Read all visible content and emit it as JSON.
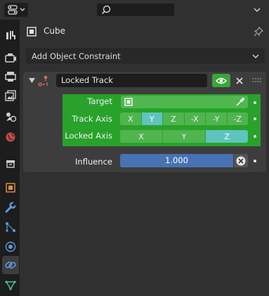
{
  "header": {
    "editor_type_icon": "properties-editor-icon",
    "search_icon": "search-icon",
    "search_placeholder": ""
  },
  "tabs": [
    {
      "name": "tool",
      "icon": "tool-icon"
    },
    {
      "name": "render",
      "icon": "render-icon"
    },
    {
      "name": "output",
      "icon": "output-icon"
    },
    {
      "name": "view-layer",
      "icon": "view-layer-icon"
    },
    {
      "name": "scene",
      "icon": "scene-icon"
    },
    {
      "name": "world",
      "icon": "world-icon"
    },
    {
      "name": "collection",
      "icon": "collection-icon"
    },
    {
      "name": "object",
      "icon": "object-icon"
    },
    {
      "name": "modifiers",
      "icon": "wrench-icon"
    },
    {
      "name": "particles",
      "icon": "particles-icon"
    },
    {
      "name": "physics",
      "icon": "physics-icon"
    },
    {
      "name": "object-constraints",
      "icon": "constraint-icon",
      "active": true
    },
    {
      "name": "object-data",
      "icon": "mesh-data-icon"
    }
  ],
  "context": {
    "object_name": "Cube"
  },
  "add_constraint": {
    "label": "Add Object Constraint"
  },
  "constraint": {
    "name": "Locked Track",
    "enabled": true,
    "target_label": "Target",
    "target_value": "",
    "track_axis_label": "Track Axis",
    "track_axis_options": [
      "X",
      "Y",
      "Z",
      "-X",
      "-Y",
      "-Z"
    ],
    "track_axis_selected": "Y",
    "locked_axis_label": "Locked Axis",
    "locked_axis_options": [
      "X",
      "Y",
      "Z"
    ],
    "locked_axis_selected": "Z",
    "influence_label": "Influence",
    "influence_value": "1.000"
  },
  "colors": {
    "selected_green": "#28a22b",
    "axis_highlight": "#5ec4c0",
    "slider_blue": "#4772b3",
    "eye_green": "#3aa63a"
  }
}
